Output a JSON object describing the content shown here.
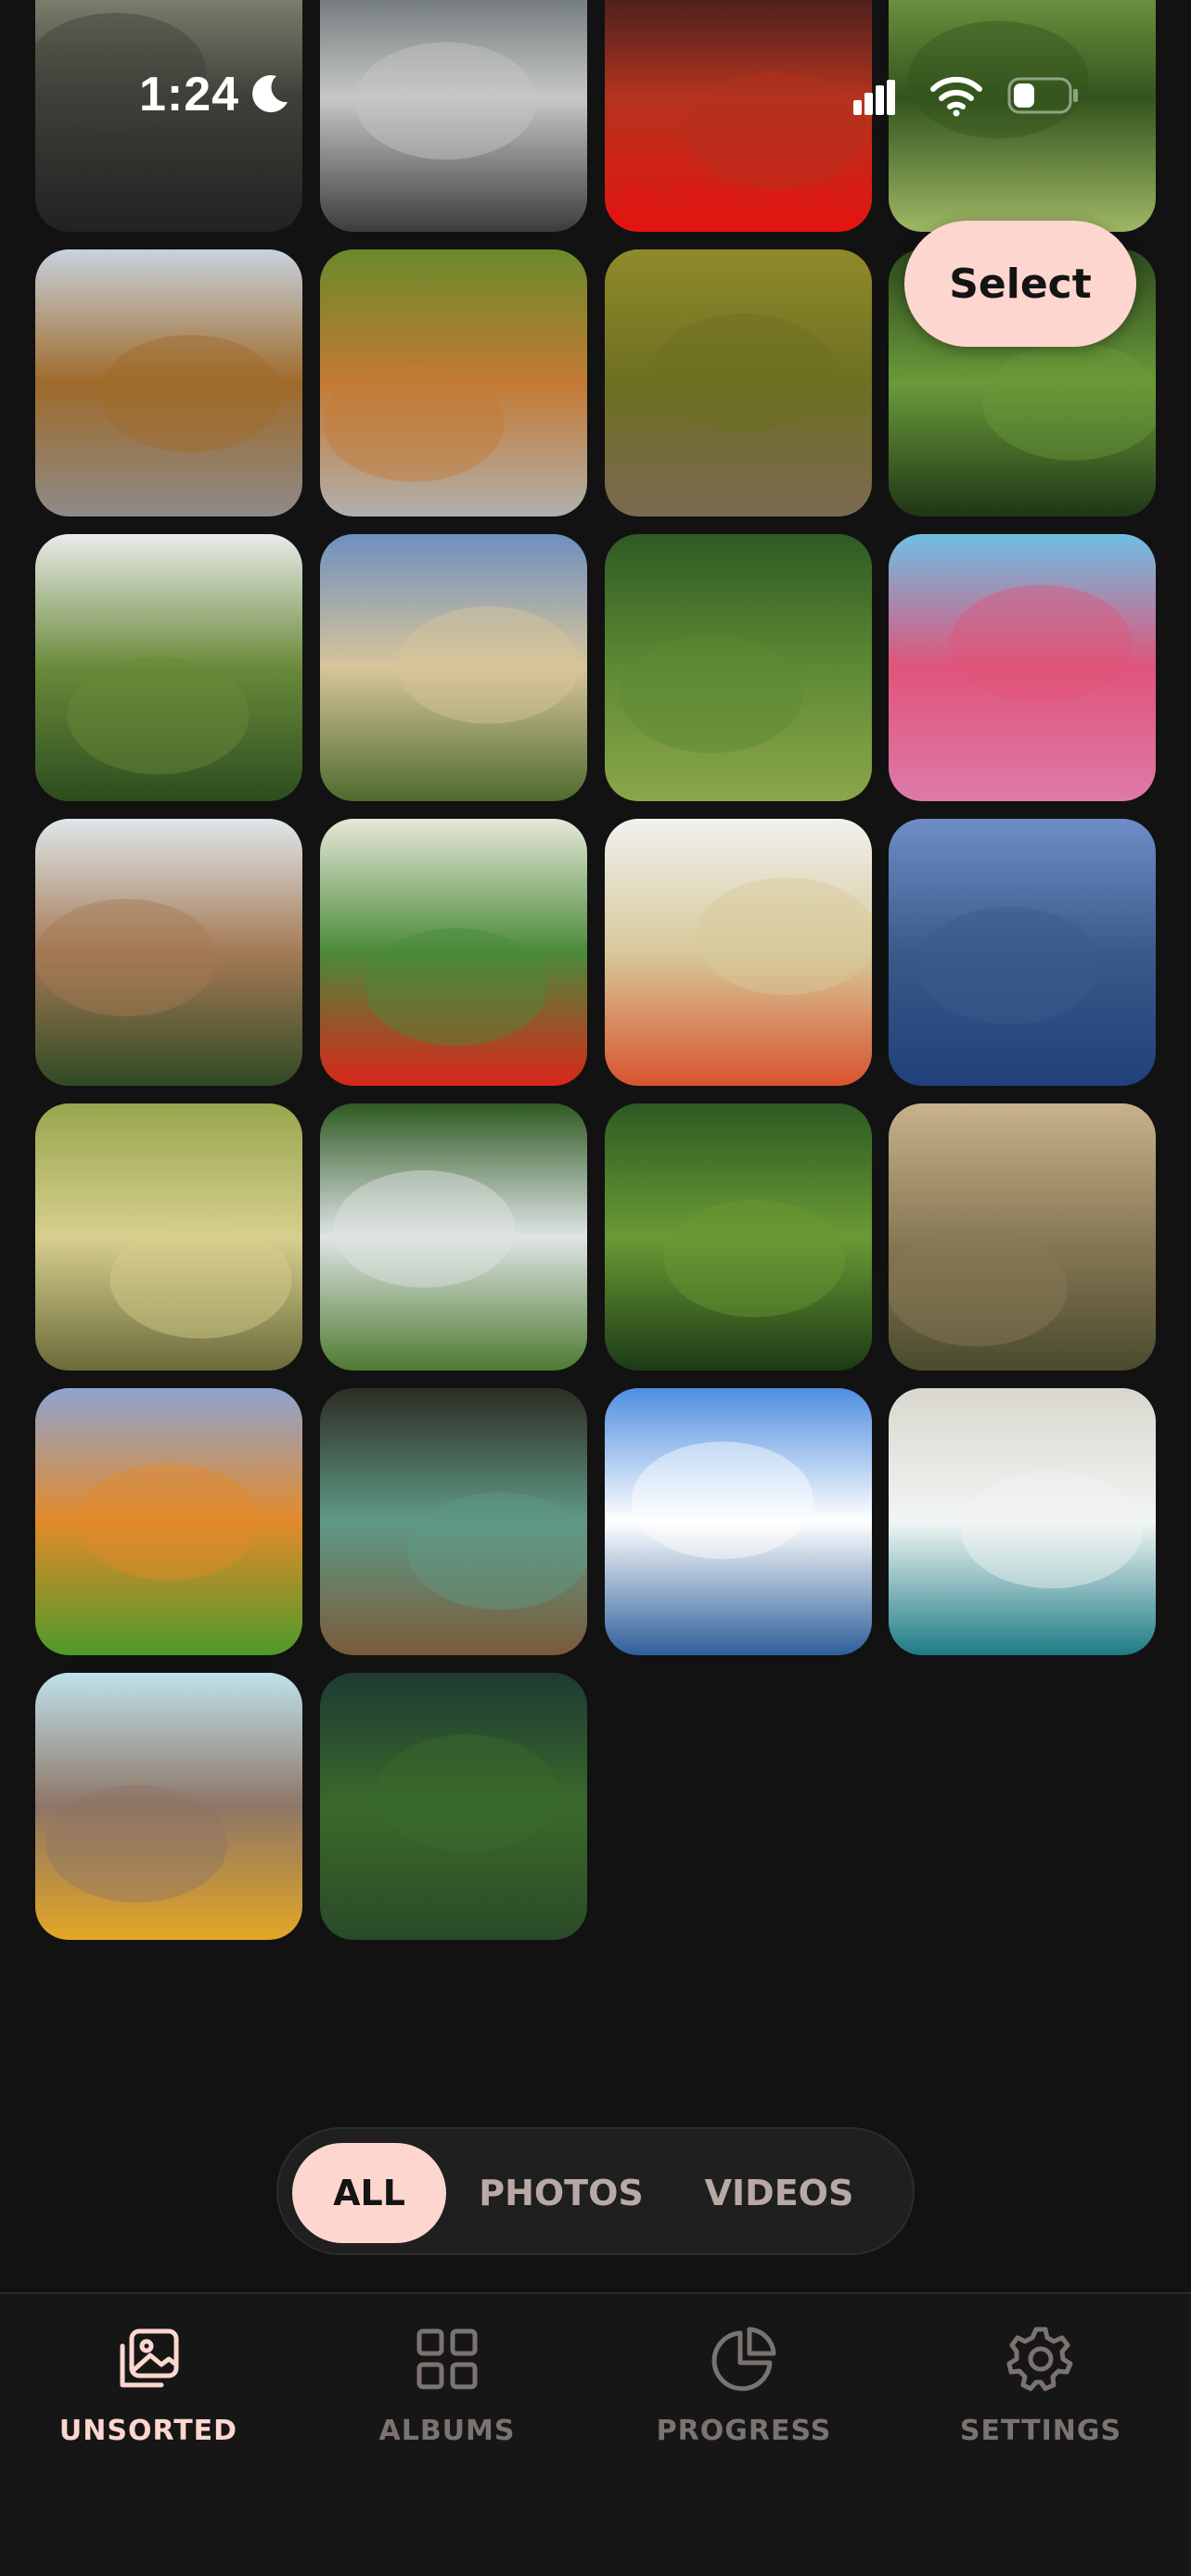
{
  "status_bar": {
    "time": "1:24",
    "icons": [
      "moon-icon",
      "cellular-signal-icon",
      "wifi-icon",
      "battery-icon"
    ]
  },
  "header": {
    "select_label": "Select"
  },
  "gallery": {
    "tiles": [
      {
        "name": "winding-road-fog-photo",
        "colors": [
          "#8f947d",
          "#3d3f38",
          "#222222"
        ]
      },
      {
        "name": "misty-mountain-valley-photo",
        "colors": [
          "#5a6367",
          "#c6c8c6",
          "#3a3d3b"
        ]
      },
      {
        "name": "red-forest-road-photo",
        "colors": [
          "#2a1a1d",
          "#b4341e",
          "#e5130f"
        ]
      },
      {
        "name": "green-forest-photo",
        "colors": [
          "#7fa44a",
          "#33541d",
          "#9fb866"
        ]
      },
      {
        "name": "autumn-road-photo",
        "colors": [
          "#c7d2dd",
          "#9f6a2a",
          "#8d8b88"
        ]
      },
      {
        "name": "autumn-winding-road-photo",
        "colors": [
          "#6a8a2a",
          "#c47a34",
          "#b0b0ad"
        ]
      },
      {
        "name": "forest-trail-photo",
        "colors": [
          "#8f8a2a",
          "#6d6f22",
          "#7b6a50"
        ]
      },
      {
        "name": "jungle-foliage-photo",
        "colors": [
          "#2d4a1d",
          "#6a9a3a",
          "#1f3616"
        ]
      },
      {
        "name": "snowy-mountain-deer-photo",
        "colors": [
          "#e9ebea",
          "#6a8a3a",
          "#2c4d1e"
        ]
      },
      {
        "name": "cloudy-cliffs-sunrise-photo",
        "colors": [
          "#6e8fbf",
          "#d8c59a",
          "#4e6b2e"
        ]
      },
      {
        "name": "aerial-forest-photo",
        "colors": [
          "#2f5a23",
          "#5e8a34",
          "#8ba64a"
        ]
      },
      {
        "name": "pink-trees-river-photo",
        "colors": [
          "#6fbfe3",
          "#e0547a",
          "#dd7aa8"
        ]
      },
      {
        "name": "half-dome-meadow-photo",
        "colors": [
          "#dfe6ea",
          "#a57a55",
          "#2f4a24"
        ]
      },
      {
        "name": "red-poppies-photo",
        "colors": [
          "#e7e8d8",
          "#4a8a3a",
          "#d9261a"
        ]
      },
      {
        "name": "poppy-field-photo",
        "colors": [
          "#f1f1ef",
          "#d7c99a",
          "#d8532e"
        ]
      },
      {
        "name": "mountain-lake-reflection-photo",
        "colors": [
          "#6f8dc7",
          "#3a5a8a",
          "#20407a"
        ]
      },
      {
        "name": "giant-tree-sunburst-photo",
        "colors": [
          "#98a64e",
          "#d7cf8e",
          "#6a6b3a"
        ]
      },
      {
        "name": "waterfall-gorge-photo",
        "colors": [
          "#2f5a23",
          "#dfe5e5",
          "#4e7a30"
        ]
      },
      {
        "name": "leafy-bokeh-photo",
        "colors": [
          "#2c5a23",
          "#6a9a34",
          "#1c3a16"
        ]
      },
      {
        "name": "misty-peaks-hiker-photo",
        "colors": [
          "#c7b28c",
          "#8a7a56",
          "#4a4a2e"
        ]
      },
      {
        "name": "spiral-meadow-sunset-photo",
        "colors": [
          "#8fa4cf",
          "#e38a2a",
          "#4e9a2a"
        ]
      },
      {
        "name": "redwood-canopy-photo",
        "colors": [
          "#2d2d24",
          "#5f9a86",
          "#7a5a3a"
        ]
      },
      {
        "name": "lake-clouds-reflection-photo",
        "colors": [
          "#4f8fe0",
          "#ffffff",
          "#2e5f9a"
        ]
      },
      {
        "name": "beach-waves-aerial-photo",
        "colors": [
          "#d9d7ce",
          "#f1f5f4",
          "#1d7c86"
        ]
      },
      {
        "name": "dolomites-flowers-photo",
        "colors": [
          "#bfe1ec",
          "#8e7666",
          "#e3a626"
        ]
      },
      {
        "name": "small-pine-tree-photo",
        "colors": [
          "#1e3a33",
          "#3a6a2a",
          "#2a4a28"
        ]
      }
    ]
  },
  "filter": {
    "options": [
      {
        "label": "ALL",
        "active": true
      },
      {
        "label": "PHOTOS",
        "active": false
      },
      {
        "label": "VIDEOS",
        "active": false
      }
    ]
  },
  "tabs": [
    {
      "label": "UNSORTED",
      "icon": "unsorted-photos-icon",
      "active": true
    },
    {
      "label": "ALBUMS",
      "icon": "albums-grid-icon",
      "active": false
    },
    {
      "label": "PROGRESS",
      "icon": "progress-pie-icon",
      "active": false
    },
    {
      "label": "SETTINGS",
      "icon": "settings-gear-icon",
      "active": false
    }
  ],
  "colors": {
    "background": "#121212",
    "accent": "#fdd6cf",
    "inactive": "#7b7370"
  }
}
